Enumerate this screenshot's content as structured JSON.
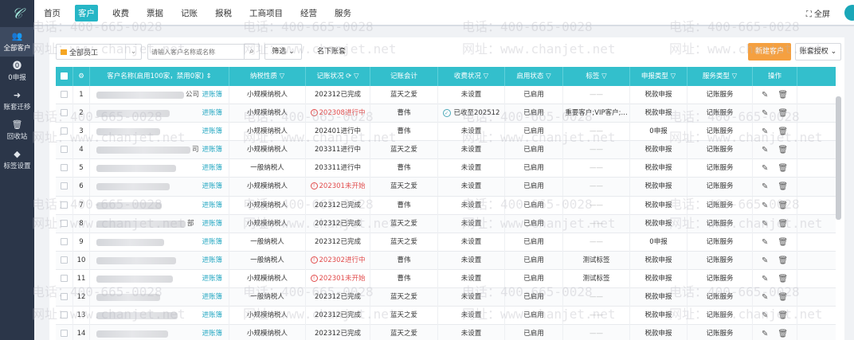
{
  "sidebar": {
    "logo": "𝒞",
    "items": [
      {
        "icon": "users-icon",
        "glyph": "👥",
        "label": "全部客户",
        "active": true
      },
      {
        "icon": "declare-icon",
        "glyph": "⓿",
        "label": "0申报",
        "active": false
      },
      {
        "icon": "transfer-icon",
        "glyph": "➜",
        "label": "账套迁移",
        "active": false
      },
      {
        "icon": "trash-icon",
        "glyph": "🗑",
        "label": "回收站",
        "active": false
      },
      {
        "icon": "tag-icon",
        "glyph": "◆",
        "label": "标签设置",
        "active": false
      }
    ]
  },
  "topnav": {
    "items": [
      "首页",
      "客户",
      "收费",
      "票据",
      "记账",
      "报税",
      "工商项目",
      "经营",
      "服务"
    ],
    "active_index": 1,
    "fullscreen_label": "全屏"
  },
  "toolbar": {
    "employee_select": "全部员工",
    "search_placeholder": "请输入客户名称或名称",
    "filter_label": "筛选",
    "account_label": "名下账套",
    "new_customer": "新建客户",
    "account_auth": "账套授权"
  },
  "table": {
    "headers": [
      "客户名称(启用100家，禁用0家)",
      "纳税性质",
      "记账状况",
      "记账会计",
      "收费状况",
      "启用状态",
      "标签",
      "申报类型",
      "服务类型",
      "操作"
    ],
    "enter_label": "进账簿",
    "rows": [
      {
        "no": "1",
        "name_tail": "公司",
        "tax": "小规模纳税人",
        "status": "202312已完成",
        "status_warn": false,
        "accountant": "蓝天之爱",
        "fee": "未设置",
        "fee_ok": false,
        "enabled": "已启用",
        "tag": "——",
        "declare": "税款申报",
        "service": "记账服务"
      },
      {
        "no": "2",
        "name_tail": "",
        "tax": "小规模纳税人",
        "status": "202308进行中",
        "status_warn": true,
        "accountant": "曹伟",
        "fee": "已收至202512",
        "fee_ok": true,
        "enabled": "已启用",
        "tag": "重要客户;VIP客户;...",
        "declare": "税款申报",
        "service": "记账服务"
      },
      {
        "no": "3",
        "name_tail": "",
        "tax": "小规模纳税人",
        "status": "202401进行中",
        "status_warn": false,
        "accountant": "曹伟",
        "fee": "未设置",
        "fee_ok": false,
        "enabled": "已启用",
        "tag": "——",
        "declare": "0申报",
        "service": "记账服务"
      },
      {
        "no": "4",
        "name_tail": "司",
        "tax": "小规模纳税人",
        "status": "203311进行中",
        "status_warn": false,
        "accountant": "蓝天之爱",
        "fee": "未设置",
        "fee_ok": false,
        "enabled": "已启用",
        "tag": "——",
        "declare": "税款申报",
        "service": "记账服务"
      },
      {
        "no": "5",
        "name_tail": "",
        "tax": "一般纳税人",
        "status": "203311进行中",
        "status_warn": false,
        "accountant": "曹伟",
        "fee": "未设置",
        "fee_ok": false,
        "enabled": "已启用",
        "tag": "——",
        "declare": "税款申报",
        "service": "记账服务"
      },
      {
        "no": "6",
        "name_tail": "",
        "tax": "小规模纳税人",
        "status": "202301未开始",
        "status_warn": true,
        "accountant": "蓝天之爱",
        "fee": "未设置",
        "fee_ok": false,
        "enabled": "已启用",
        "tag": "——",
        "declare": "税款申报",
        "service": "记账服务"
      },
      {
        "no": "7",
        "name_tail": "",
        "tax": "小规模纳税人",
        "status": "202312已完成",
        "status_warn": false,
        "accountant": "曹伟",
        "fee": "未设置",
        "fee_ok": false,
        "enabled": "已启用",
        "tag": "——",
        "declare": "税款申报",
        "service": "记账服务"
      },
      {
        "no": "8",
        "name_tail": "部",
        "tax": "小规模纳税人",
        "status": "202312已完成",
        "status_warn": false,
        "accountant": "蓝天之爱",
        "fee": "未设置",
        "fee_ok": false,
        "enabled": "已启用",
        "tag": "——",
        "declare": "税款申报",
        "service": "记账服务"
      },
      {
        "no": "9",
        "name_tail": "",
        "tax": "一般纳税人",
        "status": "202312已完成",
        "status_warn": false,
        "accountant": "蓝天之爱",
        "fee": "未设置",
        "fee_ok": false,
        "enabled": "已启用",
        "tag": "——",
        "declare": "0申报",
        "service": "记账服务"
      },
      {
        "no": "10",
        "name_tail": "",
        "tax": "一般纳税人",
        "status": "202302进行中",
        "status_warn": true,
        "accountant": "曹伟",
        "fee": "未设置",
        "fee_ok": false,
        "enabled": "已启用",
        "tag": "测试标签",
        "declare": "税款申报",
        "service": "记账服务"
      },
      {
        "no": "11",
        "name_tail": "",
        "tax": "小规模纳税人",
        "status": "202301未开始",
        "status_warn": true,
        "accountant": "曹伟",
        "fee": "未设置",
        "fee_ok": false,
        "enabled": "已启用",
        "tag": "测试标签",
        "declare": "税款申报",
        "service": "记账服务"
      },
      {
        "no": "12",
        "name_tail": "",
        "tax": "一般纳税人",
        "status": "202312已完成",
        "status_warn": false,
        "accountant": "蓝天之爱",
        "fee": "未设置",
        "fee_ok": false,
        "enabled": "已启用",
        "tag": "——",
        "declare": "税款申报",
        "service": "记账服务"
      },
      {
        "no": "13",
        "name_tail": "",
        "tax": "小规模纳税人",
        "status": "202312已完成",
        "status_warn": false,
        "accountant": "蓝天之爱",
        "fee": "未设置",
        "fee_ok": false,
        "enabled": "已启用",
        "tag": "——",
        "declare": "税款申报",
        "service": "记账服务"
      },
      {
        "no": "14",
        "name_tail": "",
        "tax": "小规模纳税人",
        "status": "202312已完成",
        "status_warn": false,
        "accountant": "蓝天之爱",
        "fee": "未设置",
        "fee_ok": false,
        "enabled": "已启用",
        "tag": "——",
        "declare": "税款申报",
        "service": "记账服务"
      }
    ]
  },
  "watermarks": {
    "phone": "电话：400-665-0028",
    "site": "网址：www.chanjet.net"
  },
  "colors": {
    "sidebar_bg": "#2b3649",
    "header_bg": "#33bfcc",
    "accent": "#26b6c6",
    "primary_button": "#f5a040",
    "warning": "#e24c4c"
  }
}
